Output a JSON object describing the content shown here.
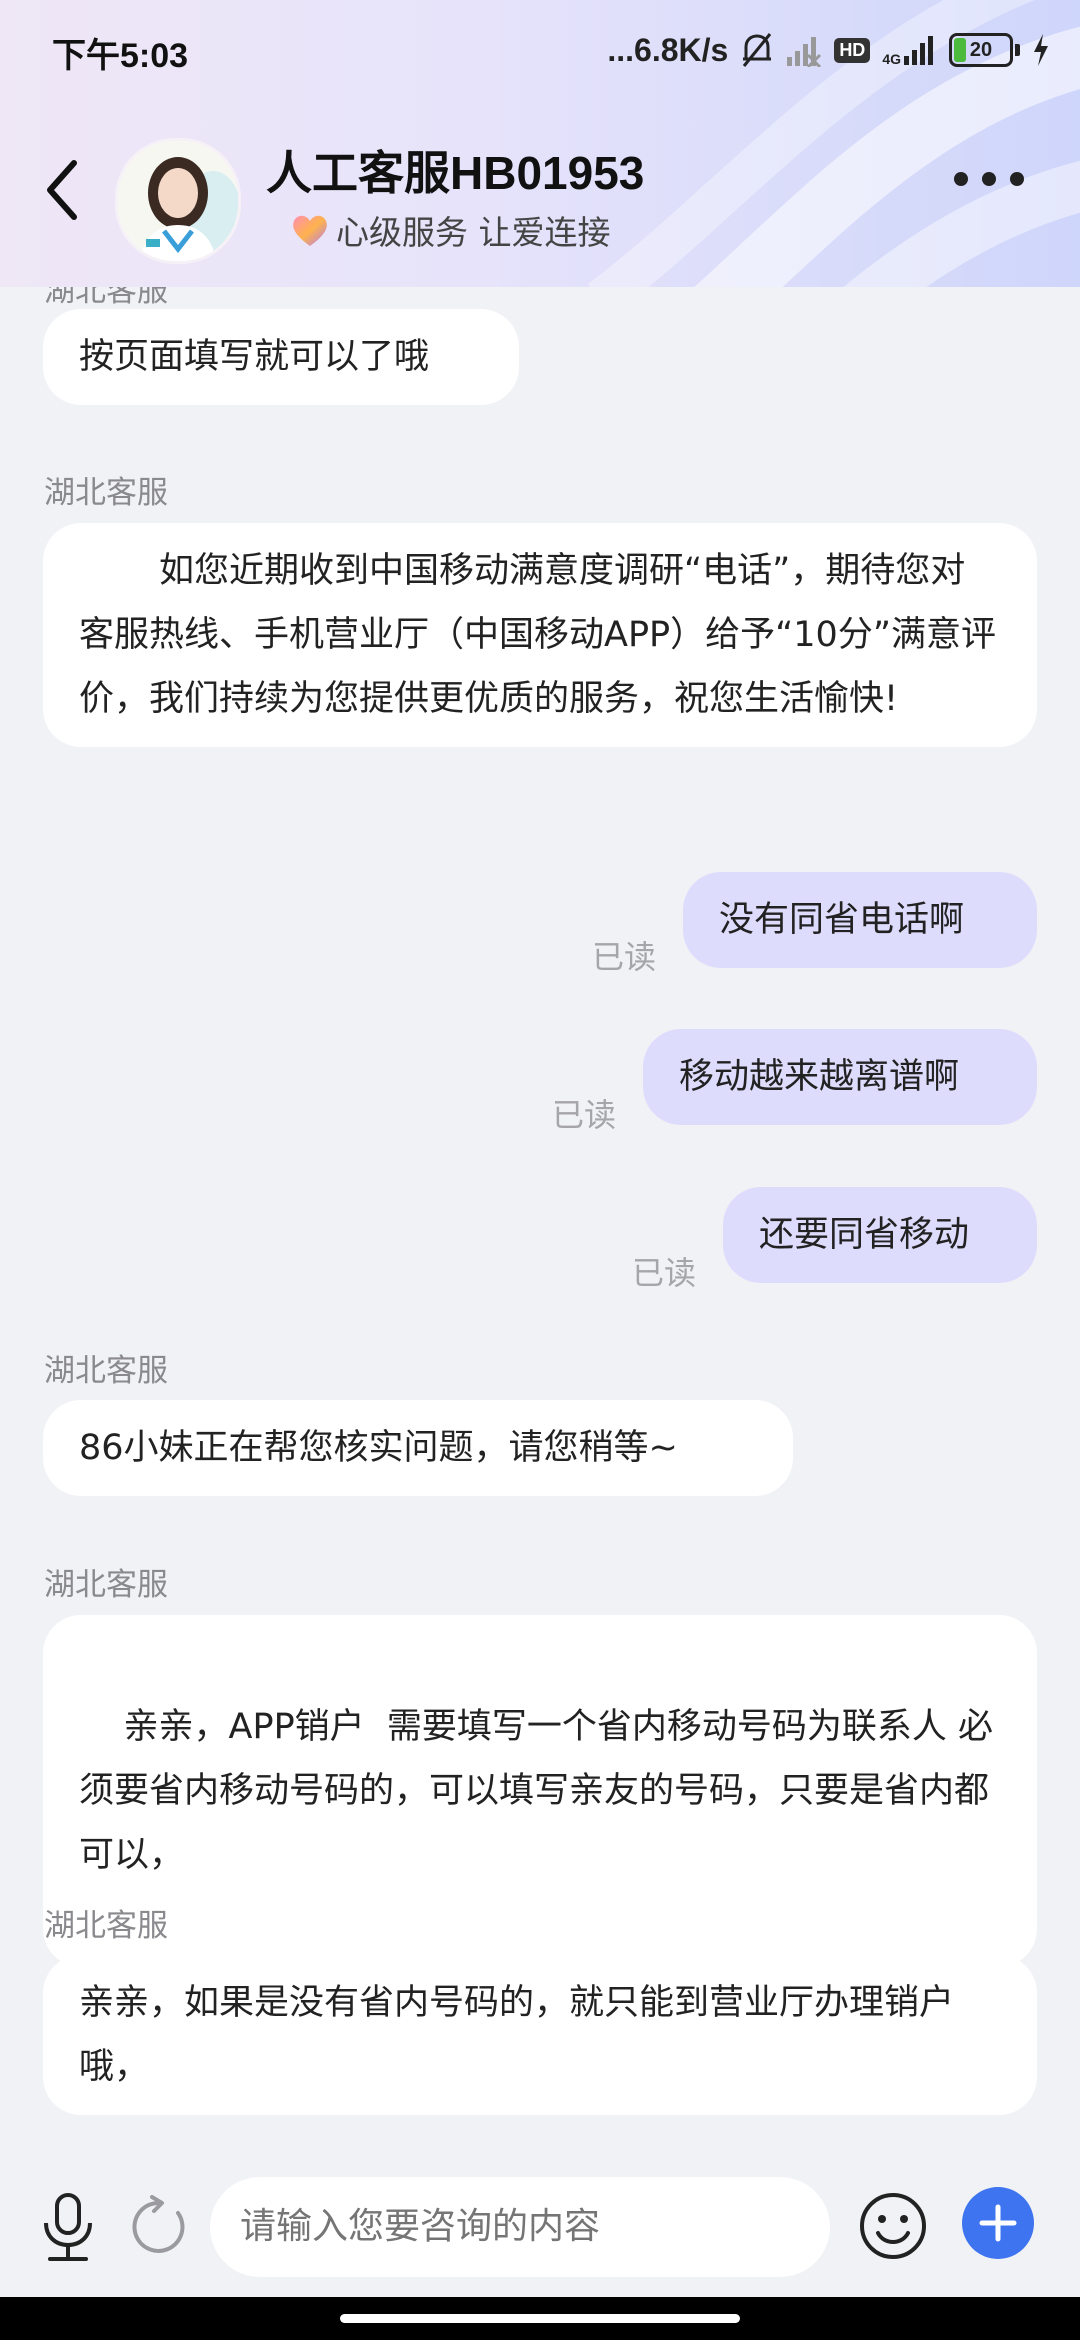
{
  "status_bar": {
    "time": "下午5:03",
    "network_speed": "...6.8K/s",
    "hd_badge": "HD",
    "signal_label": "4G",
    "battery_level": "20"
  },
  "header": {
    "title": "人工客服HB01953",
    "slogan": "心级服务 让爱连接"
  },
  "messages": [
    {
      "side": "in",
      "sender": "",
      "text": "按页面填写就可以了哦"
    },
    {
      "side": "in",
      "sender": "湖北客服",
      "text": "如您近期收到中国移动满意度调研“电话”，期待您对客服热线、手机营业厅（中国移动APP）给予“10分”满意评价，我们持续为您提供更优质的服务，祝您生活愉快!"
    },
    {
      "side": "out",
      "status": "已读",
      "text": "没有同省电话啊"
    },
    {
      "side": "out",
      "status": "已读",
      "text": "移动越来越离谱啊"
    },
    {
      "side": "out",
      "status": "已读",
      "text": "还要同省移动"
    },
    {
      "side": "in",
      "sender": "湖北客服",
      "text": "86小妹正在帮您核实问题，请您稍等~"
    },
    {
      "side": "in",
      "sender": "湖北客服",
      "text": "亲亲，APP销户  需要填写一个省内移动号码为联系人 必须要省内移动号码的，可以填写亲友的号码，只要是省内都可以，"
    },
    {
      "side": "in",
      "sender": "湖北客服",
      "text": "亲亲，如果是没有省内号码的，就只能到营业厅办理销户哦，"
    }
  ],
  "input": {
    "placeholder": "请输入您要咨询的内容"
  },
  "colors": {
    "accent": "#3e74ef",
    "outgoing_bubble": "#dedcfc",
    "incoming_bubble": "#ffffff"
  }
}
